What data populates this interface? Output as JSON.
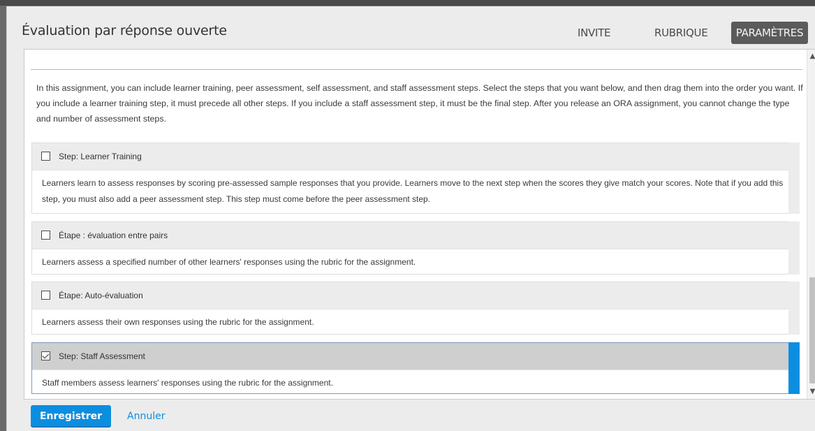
{
  "modal": {
    "title": "Évaluation par réponse ouverte",
    "tabs": [
      {
        "label": "INVITE"
      },
      {
        "label": "RUBRIQUE"
      },
      {
        "label": "PARAMÈTRES",
        "active": true
      }
    ]
  },
  "settings": {
    "intro": "In this assignment, you can include learner training, peer assessment, self assessment, and staff assessment steps. Select the steps that you want below, and then drag them into the order you want. If you include a learner training step, it must precede all other steps. If you include a staff assessment step, it must be the final step. After you release an ORA assignment, you cannot change the type and number of assessment steps.",
    "steps": [
      {
        "title": "Step: Learner Training",
        "checked": false,
        "description": "Learners learn to assess responses by scoring pre-assessed sample responses that you provide. Learners move to the next step when the scores they give match your scores. Note that if you add this step, you must also add a peer assessment step. This step must come before the peer assessment step."
      },
      {
        "title": "Étape : évaluation entre pairs",
        "checked": false,
        "description": "Learners assess a specified number of other learners' responses using the rubric for the assignment."
      },
      {
        "title": "Étape: Auto-évaluation",
        "checked": false,
        "description": "Learners assess their own responses using the rubric for the assignment."
      },
      {
        "title": "Step: Staff Assessment",
        "checked": true,
        "description": "Staff members assess learners' responses using the rubric for the assignment."
      }
    ]
  },
  "footer": {
    "save_label": "Enregistrer",
    "cancel_label": "Annuler"
  },
  "colors": {
    "accent": "#0c8ee0",
    "active_tab": "#5b5b5b"
  }
}
